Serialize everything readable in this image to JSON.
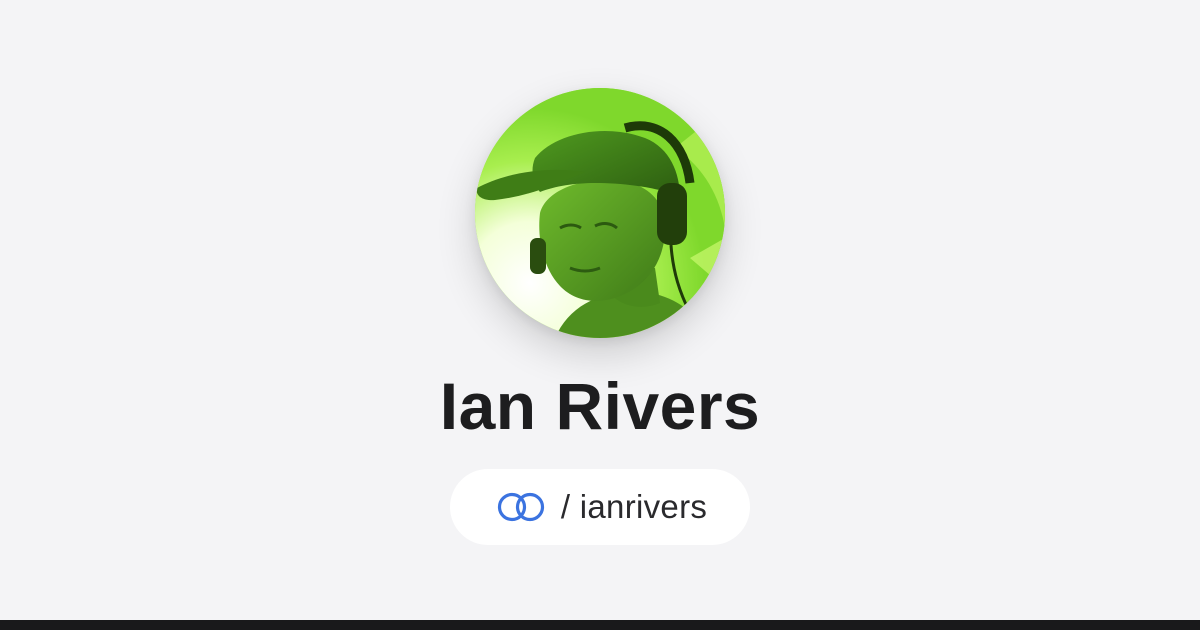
{
  "profile": {
    "name": "Ian Rivers",
    "handle": "ianrivers",
    "handle_separator": "/",
    "avatar_alt": "profile-photo"
  },
  "icons": {
    "handle_icon": "linked-rings-icon"
  },
  "colors": {
    "background": "#f4f4f6",
    "name_text": "#1d1d1f",
    "handle_text": "#2a2a2d",
    "pill_background": "#ffffff",
    "icon_accent": "#3b73e0",
    "bottom_bar": "#19191b",
    "avatar_tint": "#8ee33a"
  }
}
